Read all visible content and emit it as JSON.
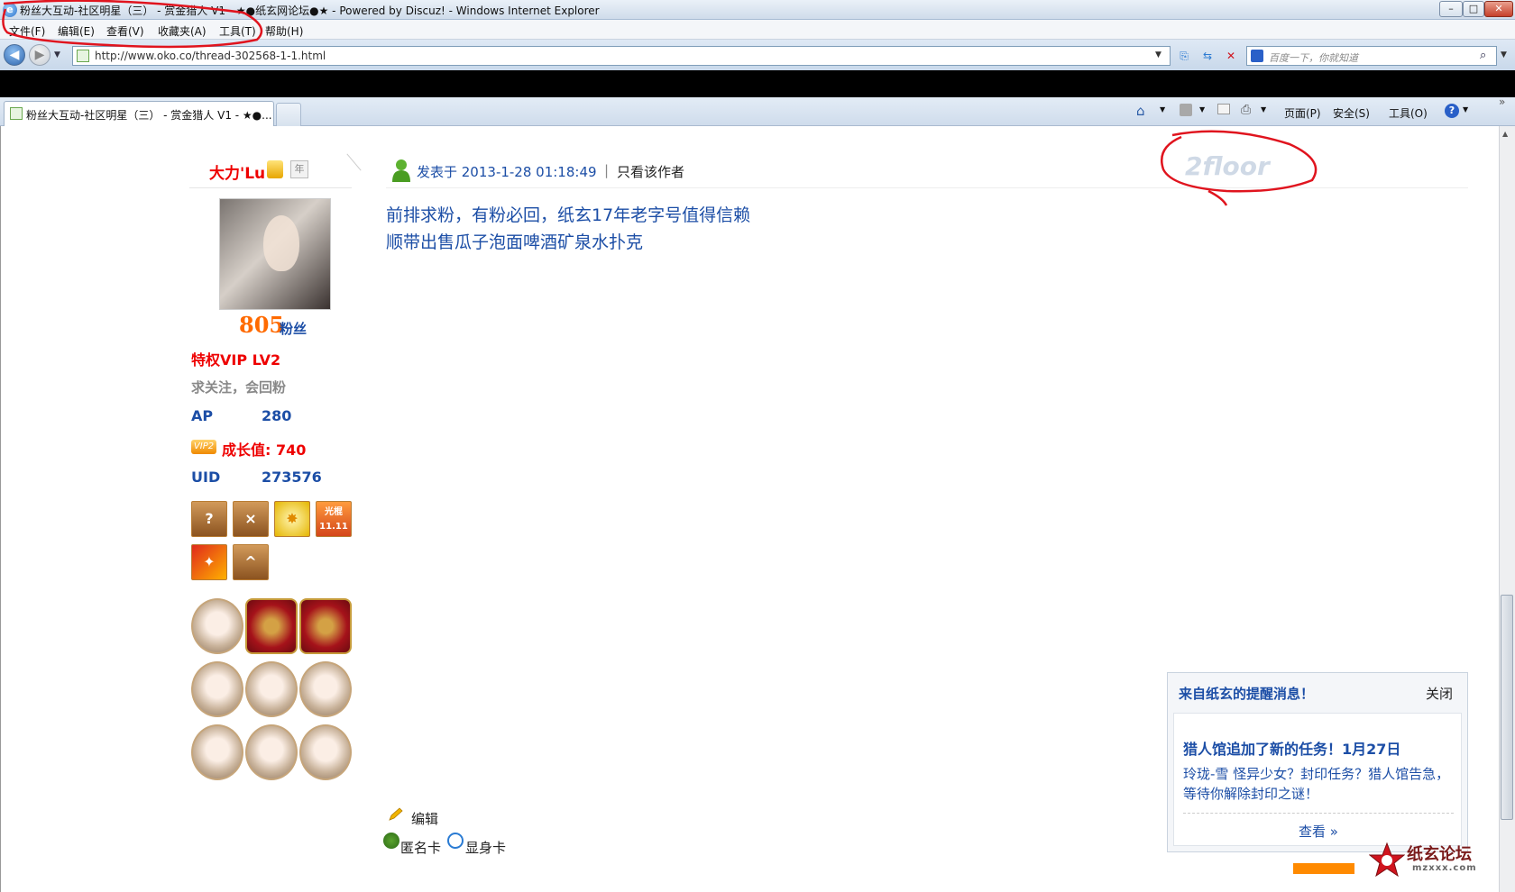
{
  "window": {
    "title": "粉丝大互动-社区明星（三） - 赏金猎人 V1 - ★●纸玄网论坛●★ - Powered by Discuz! - Windows Internet Explorer",
    "controls": {
      "minimize": "–",
      "maximize": "□",
      "close": "✕"
    }
  },
  "menu": [
    "文件(F)",
    "编辑(E)",
    "查看(V)",
    "收藏夹(A)",
    "工具(T)",
    "帮助(H)"
  ],
  "address": {
    "url": "http://www.oko.co/thread-302568-1-1.html",
    "search_placeholder": "百度一下，你就知道"
  },
  "tabs": [
    {
      "label": "粉丝大互动-社区明星（三） - 赏金猎人 V1 - ★●..."
    }
  ],
  "command_bar": {
    "page": "页面(P)",
    "safety": "安全(S)",
    "tools": "工具(O)"
  },
  "author": {
    "name": "大力'Lu",
    "year_badge": "年",
    "fans_count": "805",
    "fans_label": "粉丝",
    "vip": "特权VIP LV2",
    "signature": "求关注，会回粉",
    "ap_label": "AP",
    "ap_value": "280",
    "vip2_badge": "VIP2",
    "growth": "成长值: 740",
    "uid_label": "UID",
    "uid_value": "273576",
    "medals": [
      {
        "icon": "question-face-icon",
        "text": "?"
      },
      {
        "icon": "dizzy-face-icon",
        "text": "×"
      },
      {
        "icon": "sunburst-icon",
        "text": "✸"
      },
      {
        "icon": "singles-day-icon",
        "text": "光棍 11.11"
      },
      {
        "icon": "flame-hand-icon",
        "text": "✦"
      },
      {
        "icon": "grin-face-icon",
        "text": "^"
      }
    ]
  },
  "post": {
    "posted_at": "发表于 2013-1-28 01:18:49",
    "separator": "|",
    "only_author": "只看该作者",
    "floor": "2floor",
    "lines": [
      "前排求粉，有粉必回，纸玄17年老字号值得信赖",
      "顺带出售瓜子泡面啤酒矿泉水扑克"
    ],
    "edit": "编辑",
    "anon_card": "匿名卡",
    "reveal_card": "显身卡"
  },
  "notice": {
    "title": "来自纸玄的提醒消息！",
    "close": "关闭",
    "headline": "猎人馆追加了新的任务！1月27日",
    "body": "玲珑-雪 怪异少女？封印任务？猎人馆告急，等待你解除封印之谜！",
    "view": "查看 »"
  },
  "watermark": {
    "logo": "纸玄论坛",
    "site": "mzxxx.com"
  },
  "colors": {
    "link_blue": "#1c4ea6",
    "alert_red": "#e00000",
    "fans_orange": "#ff6a00"
  }
}
